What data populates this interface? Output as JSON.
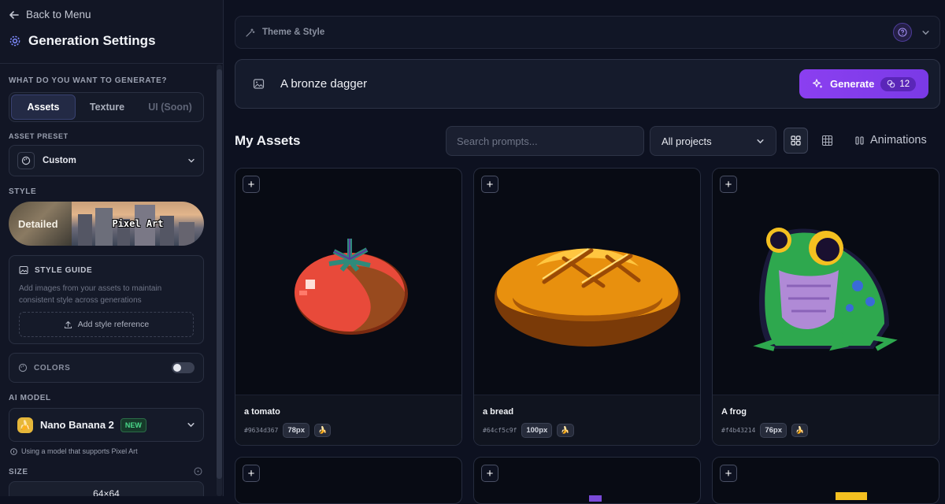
{
  "sidebar": {
    "back_label": "Back to Menu",
    "title": "Generation Settings",
    "what_label": "WHAT DO YOU WANT TO GENERATE?",
    "tabs": [
      {
        "label": "Assets",
        "active": true
      },
      {
        "label": "Texture",
        "active": false
      },
      {
        "label": "UI (Soon)",
        "active": false
      }
    ],
    "preset_label": "ASSET PRESET",
    "preset_value": "Custom",
    "style_label": "STYLE",
    "style_options": [
      "Detailed",
      "Pixel Art"
    ],
    "guide_title": "STYLE GUIDE",
    "guide_desc": "Add images from your assets to maintain consistent style across generations",
    "guide_button": "Add style reference",
    "colors_label": "COLORS",
    "colors_enabled": false,
    "model_label": "AI MODEL",
    "model_value": "Nano Banana 2",
    "model_badge": "NEW",
    "model_hint": "Using a model that supports Pixel Art",
    "size_label": "SIZE",
    "size_value": "64×64"
  },
  "main": {
    "theme_label": "Theme & Style",
    "prompt": "A bronze dagger",
    "generate_label": "Generate",
    "credits": "12",
    "assets_title": "My Assets",
    "search_placeholder": "Search prompts...",
    "projects_value": "All projects",
    "animations_label": "Animations",
    "assets": [
      {
        "name": "a tomato",
        "hash": "#9634d367",
        "size": "78px"
      },
      {
        "name": "a bread",
        "hash": "#64cf5c9f",
        "size": "100px"
      },
      {
        "name": "A frog",
        "hash": "#f4b43214",
        "size": "76px"
      }
    ]
  },
  "colors": {
    "accent": "#8b3ff0",
    "background": "#0d1120",
    "sidebar": "#121625",
    "new_badge": "#4ad98a"
  }
}
